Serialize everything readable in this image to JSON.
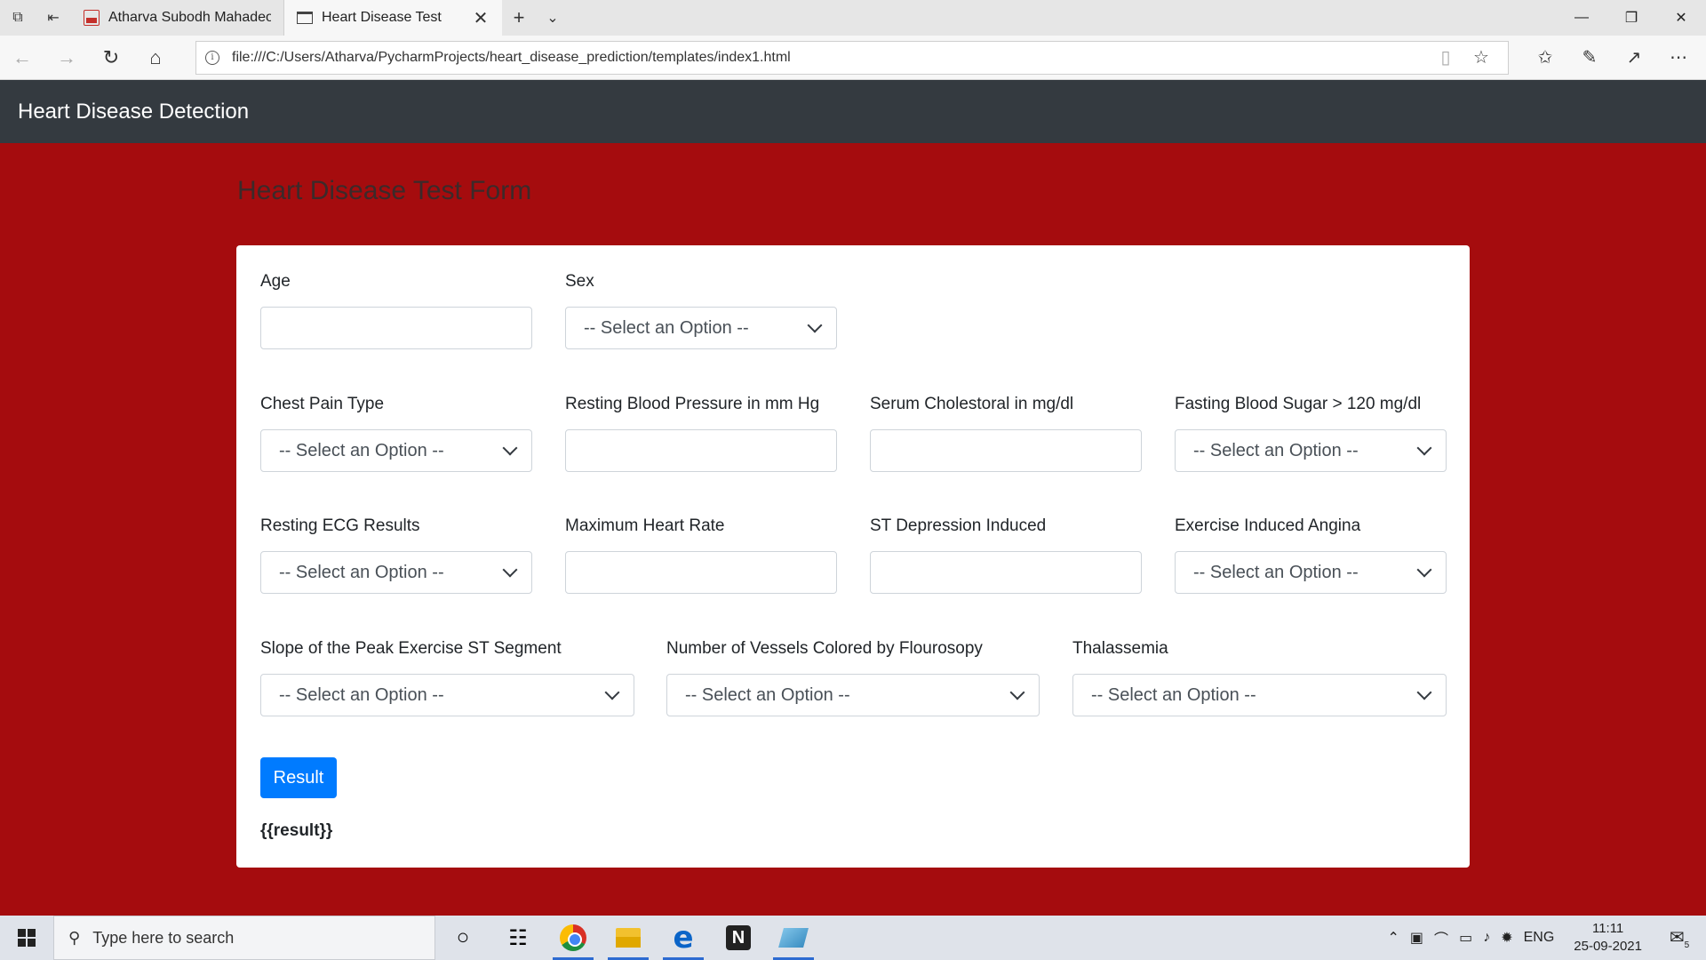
{
  "browser": {
    "tabs": [
      {
        "title": "Atharva Subodh Mahadeokar",
        "active": false
      },
      {
        "title": "Heart Disease Test",
        "active": true
      }
    ],
    "address": "file:///C:/Users/Atharva/PycharmProjects/heart_disease_prediction/templates/index1.html"
  },
  "navbar": {
    "brand": "Heart Disease Detection"
  },
  "page": {
    "heading": "Heart Disease Test Form"
  },
  "form": {
    "age": {
      "label": "Age",
      "value": ""
    },
    "sex": {
      "label": "Sex",
      "selected": "-- Select an Option --"
    },
    "chest_pain": {
      "label": "Chest Pain Type",
      "selected": "-- Select an Option --"
    },
    "resting_bp": {
      "label": "Resting Blood Pressure in mm Hg",
      "value": ""
    },
    "cholesterol": {
      "label": "Serum Cholestoral in mg/dl",
      "value": ""
    },
    "fbs": {
      "label": "Fasting Blood Sugar > 120 mg/dl",
      "selected": "-- Select an Option --"
    },
    "ecg": {
      "label": "Resting ECG Results",
      "selected": "-- Select an Option --"
    },
    "max_hr": {
      "label": "Maximum Heart Rate",
      "value": ""
    },
    "st_depression": {
      "label": "ST Depression Induced",
      "value": ""
    },
    "exang": {
      "label": "Exercise Induced Angina",
      "selected": "-- Select an Option --"
    },
    "slope": {
      "label": "Slope of the Peak Exercise ST Segment",
      "selected": "-- Select an Option --"
    },
    "vessels": {
      "label": "Number of Vessels Colored by Flourosopy",
      "selected": "-- Select an Option --"
    },
    "thal": {
      "label": "Thalassemia",
      "selected": "-- Select an Option --"
    },
    "submit_label": "Result",
    "result_placeholder": "{{result}}"
  },
  "taskbar": {
    "search_placeholder": "Type here to search",
    "language": "ENG",
    "time": "11:11",
    "date": "25-09-2021",
    "notification_count": "5"
  },
  "colors": {
    "page_background": "#a50c0e",
    "navbar": "#343a40",
    "primary_button": "#007bff"
  }
}
